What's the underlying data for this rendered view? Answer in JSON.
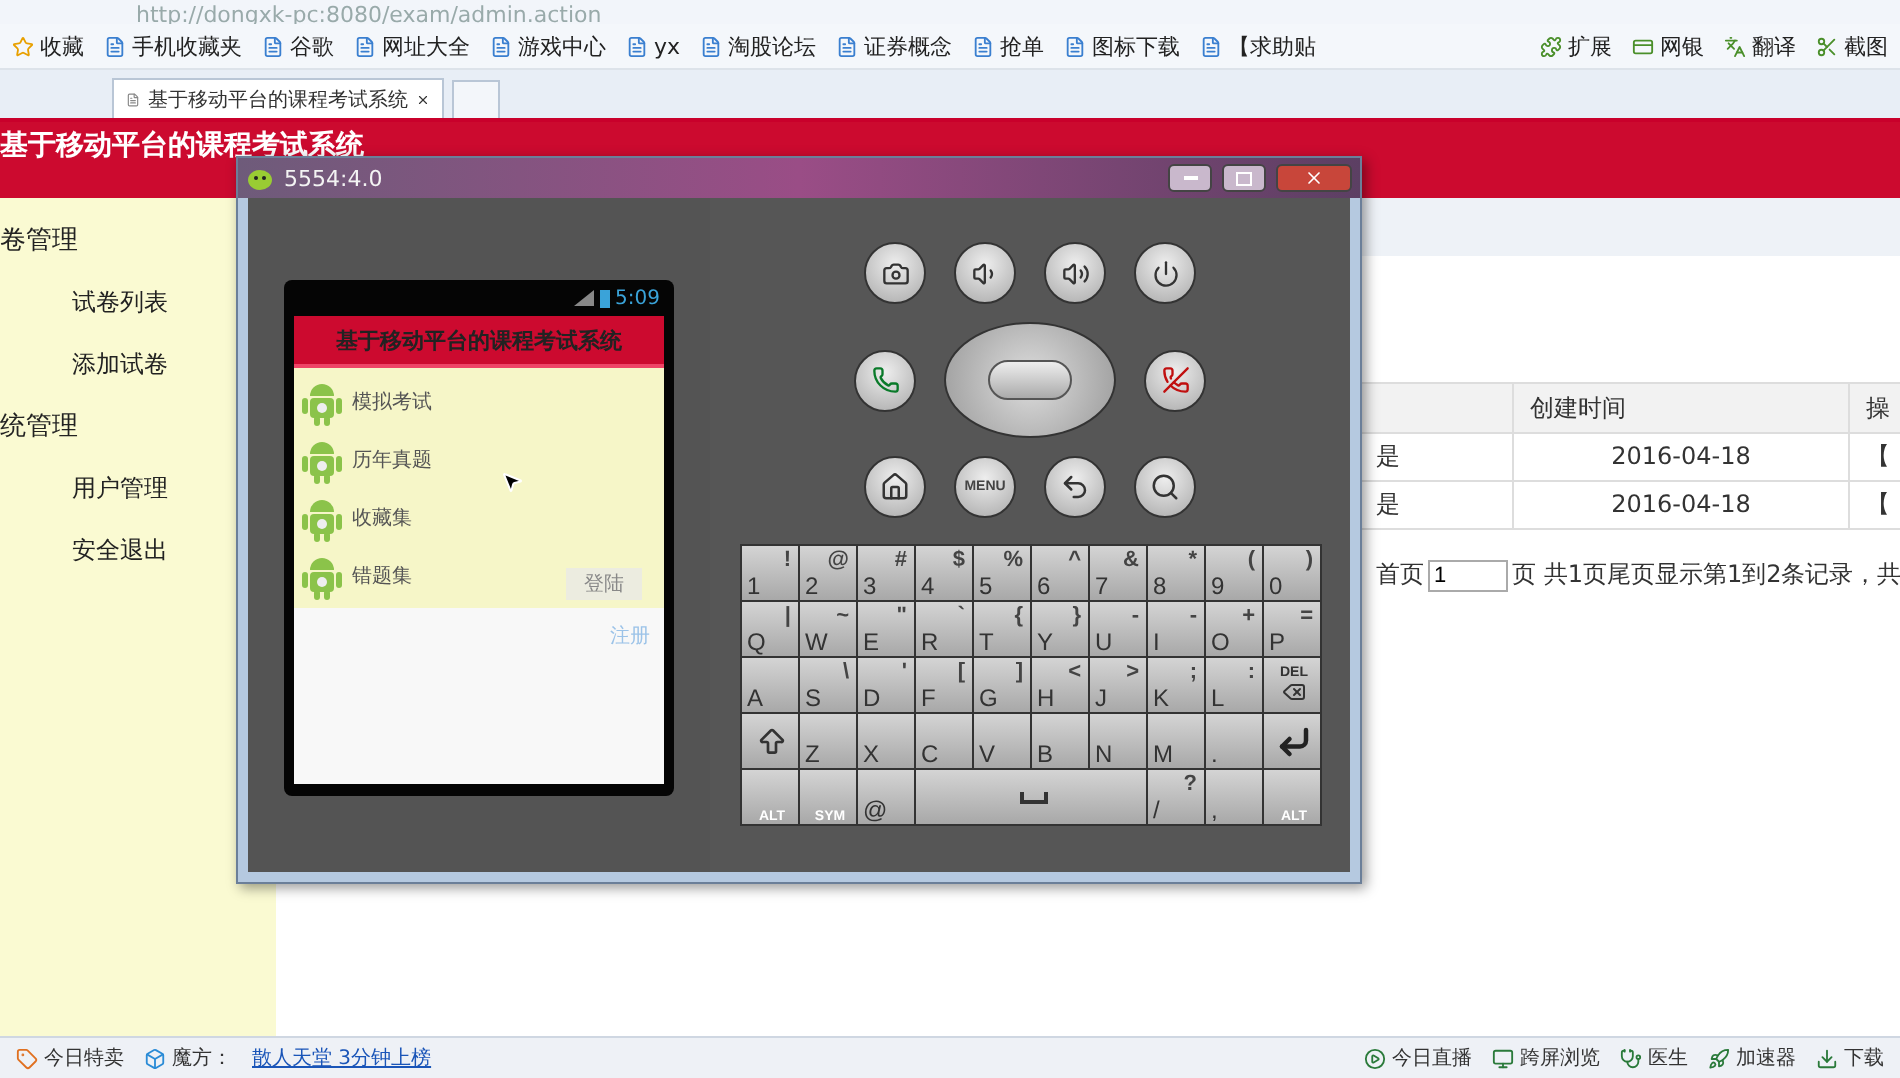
{
  "browser": {
    "address": "http://dongxk-pc:8080/exam/admin.action",
    "bookmarks": [
      {
        "label": "收藏"
      },
      {
        "label": "手机收藏夹"
      },
      {
        "label": "谷歌"
      },
      {
        "label": "网址大全"
      },
      {
        "label": "游戏中心"
      },
      {
        "label": "yx"
      },
      {
        "label": "淘股论坛"
      },
      {
        "label": "证券概念"
      },
      {
        "label": "抢单"
      },
      {
        "label": "图标下载"
      },
      {
        "label": "【求助贴"
      }
    ],
    "tools": [
      {
        "label": "扩展"
      },
      {
        "label": "网银"
      },
      {
        "label": "翻译"
      },
      {
        "label": "截图"
      }
    ],
    "tabs": [
      {
        "label": "基于移动平台的课程考试系统",
        "selected": true
      }
    ]
  },
  "site": {
    "title": "基于移动平台的课程考试系统",
    "sidebar": [
      {
        "label": "卷管理",
        "children": [
          {
            "label": "试卷列表"
          },
          {
            "label": "添加试卷"
          }
        ]
      },
      {
        "label": "统管理",
        "children": [
          {
            "label": "用户管理"
          },
          {
            "label": "安全退出"
          }
        ]
      }
    ],
    "table": {
      "headers": {
        "created": "创建时间",
        "actions": "操"
      },
      "rows": [
        {
          "column_2": "是",
          "created": "2016-04-18",
          "actions": "【"
        },
        {
          "column_2": "是",
          "created": "2016-04-18",
          "actions": "【"
        }
      ]
    },
    "pager": {
      "first": "首页",
      "page_value": "1",
      "summary": "页 共1页尾页显示第1到2条记录，共"
    }
  },
  "emulator": {
    "title": "5554:4.0",
    "phone": {
      "clock": "5:09",
      "app_title": "基于移动平台的课程考试系统",
      "menu": [
        {
          "label": "模拟考试"
        },
        {
          "label": "历年真题"
        },
        {
          "label": "收藏集"
        },
        {
          "label": "错题集"
        }
      ],
      "login_button": "登陆",
      "register_link": "注册"
    },
    "menu_key": "MENU",
    "keyboard": [
      [
        {
          "kind": "char",
          "main": "1",
          "alt": "!"
        },
        {
          "kind": "char",
          "main": "2",
          "alt": "@"
        },
        {
          "kind": "char",
          "main": "3",
          "alt": "#"
        },
        {
          "kind": "char",
          "main": "4",
          "alt": "$"
        },
        {
          "kind": "char",
          "main": "5",
          "alt": "%"
        },
        {
          "kind": "char",
          "main": "6",
          "alt": "^"
        },
        {
          "kind": "char",
          "main": "7",
          "alt": "&"
        },
        {
          "kind": "char",
          "main": "8",
          "alt": "*"
        },
        {
          "kind": "char",
          "main": "9",
          "alt": "("
        },
        {
          "kind": "char",
          "main": "0",
          "alt": ")"
        }
      ],
      [
        {
          "kind": "char",
          "main": "Q",
          "alt": "|"
        },
        {
          "kind": "char",
          "main": "W",
          "alt": "~"
        },
        {
          "kind": "char",
          "main": "E",
          "alt": "\""
        },
        {
          "kind": "char",
          "main": "R",
          "alt": "`"
        },
        {
          "kind": "char",
          "main": "T",
          "alt": "{"
        },
        {
          "kind": "char",
          "main": "Y",
          "alt": "}"
        },
        {
          "kind": "char",
          "main": "U",
          "alt": "-"
        },
        {
          "kind": "char",
          "main": "I",
          "alt": "-"
        },
        {
          "kind": "char",
          "main": "O",
          "alt": "+"
        },
        {
          "kind": "char",
          "main": "P",
          "alt": "="
        }
      ],
      [
        {
          "kind": "char",
          "main": "A"
        },
        {
          "kind": "char",
          "main": "S",
          "alt": "\\"
        },
        {
          "kind": "char",
          "main": "D",
          "alt": "'"
        },
        {
          "kind": "char",
          "main": "F",
          "alt": "["
        },
        {
          "kind": "char",
          "main": "G",
          "alt": "]"
        },
        {
          "kind": "char",
          "main": "H",
          "alt": "<"
        },
        {
          "kind": "char",
          "main": "J",
          "alt": ">"
        },
        {
          "kind": "char",
          "main": "K",
          "alt": ";"
        },
        {
          "kind": "char",
          "main": "L",
          "alt": ":"
        },
        {
          "kind": "del",
          "main": "DEL"
        }
      ],
      [
        {
          "kind": "shift"
        },
        {
          "kind": "char",
          "main": "Z"
        },
        {
          "kind": "char",
          "main": "X"
        },
        {
          "kind": "char",
          "main": "C"
        },
        {
          "kind": "char",
          "main": "V"
        },
        {
          "kind": "char",
          "main": "B"
        },
        {
          "kind": "char",
          "main": "N"
        },
        {
          "kind": "char",
          "main": "M"
        },
        {
          "kind": "char",
          "main": "."
        },
        {
          "kind": "enter"
        }
      ],
      [
        {
          "kind": "mod",
          "main": "ALT"
        },
        {
          "kind": "mod",
          "main": "SYM"
        },
        {
          "kind": "char",
          "main": "@"
        },
        {
          "kind": "space"
        },
        {
          "kind": "char",
          "main": "/",
          "alt": "?"
        },
        {
          "kind": "char",
          "main": ","
        },
        {
          "kind": "mod",
          "main": "ALT"
        }
      ]
    ]
  },
  "status_bar": {
    "left": [
      {
        "label": "今日特卖"
      },
      {
        "label": "魔方："
      }
    ],
    "link": "散人天堂 3分钟上榜",
    "right": [
      {
        "label": "今日直播"
      },
      {
        "label": "跨屏浏览"
      },
      {
        "label": "医生"
      },
      {
        "label": "加速器"
      },
      {
        "label": "下载"
      }
    ]
  }
}
